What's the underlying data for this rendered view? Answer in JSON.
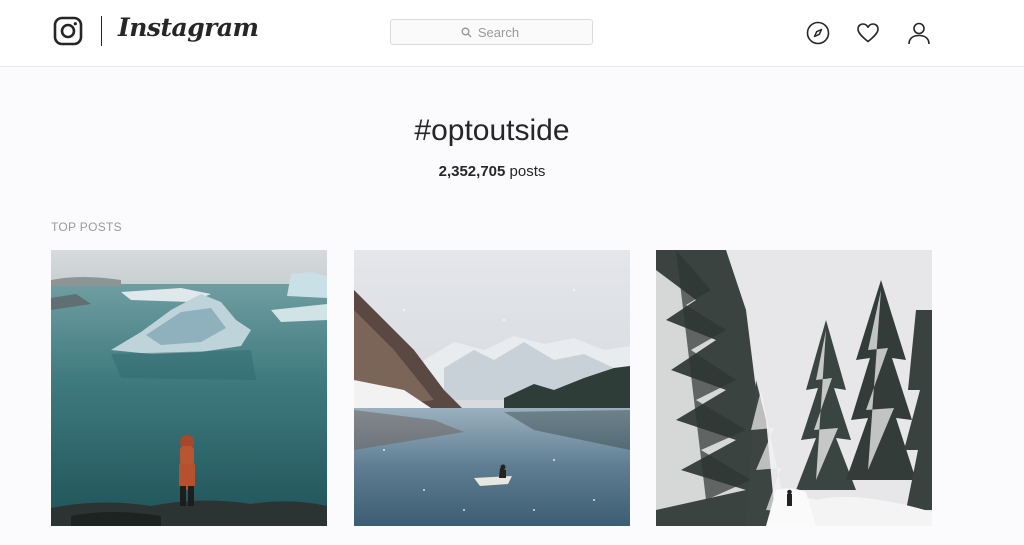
{
  "header": {
    "logo_text": "Instagram",
    "search_placeholder": "Search",
    "icons": [
      "instagram-glyph-icon",
      "search-icon",
      "compass-icon",
      "heart-icon",
      "user-icon"
    ]
  },
  "hashtag": {
    "title": "#optoutside",
    "post_count": "2,352,705",
    "post_count_label": "posts"
  },
  "sections": {
    "top_posts_label": "TOP POSTS"
  },
  "colors": {
    "background": "#fbfafc",
    "text": "#262626",
    "muted": "#999999",
    "border": "#dbdbdb"
  }
}
